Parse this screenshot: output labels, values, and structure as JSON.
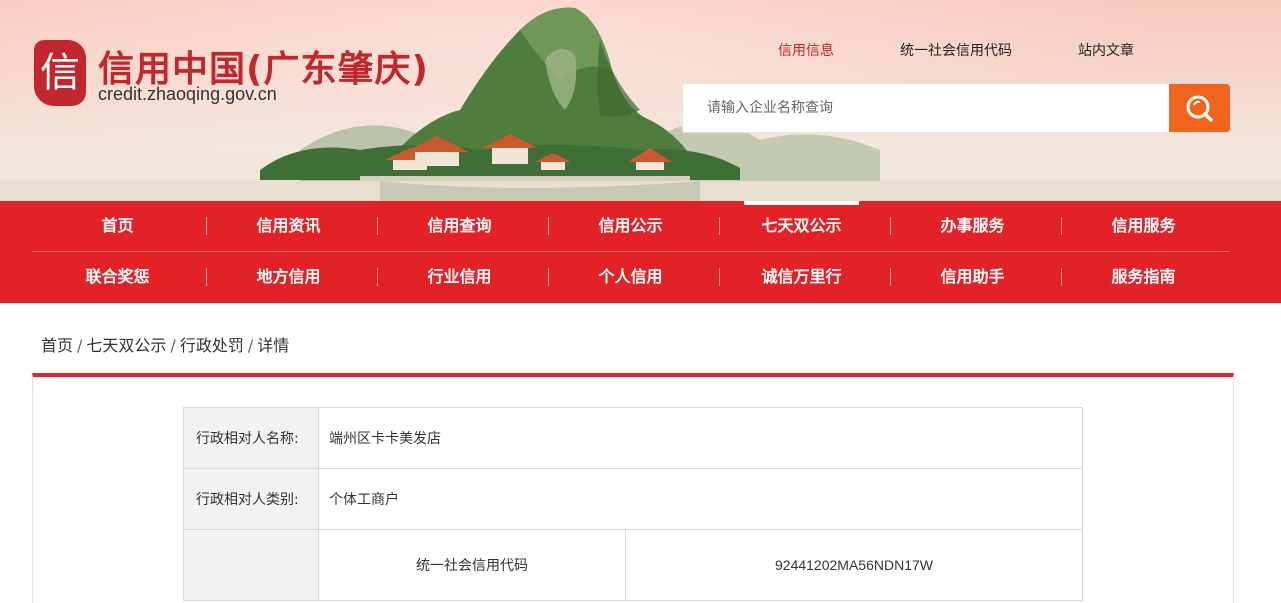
{
  "brand": {
    "seal_char": "信",
    "title": "信用中国(广东肇庆)",
    "url": "credit.zhaoqing.gov.cn"
  },
  "search": {
    "tabs": [
      {
        "label": "信用信息",
        "active": true
      },
      {
        "label": "统一社会信用代码",
        "active": false
      },
      {
        "label": "站内文章",
        "active": false
      }
    ],
    "placeholder": "请输入企业名称查询",
    "button_icon": "search-icon"
  },
  "nav": {
    "row1": [
      {
        "label": "首页"
      },
      {
        "label": "信用资讯"
      },
      {
        "label": "信用查询"
      },
      {
        "label": "信用公示"
      },
      {
        "label": "七天双公示",
        "active": true
      },
      {
        "label": "办事服务"
      },
      {
        "label": "信用服务"
      }
    ],
    "row2": [
      {
        "label": "联合奖惩"
      },
      {
        "label": "地方信用"
      },
      {
        "label": "行业信用"
      },
      {
        "label": "个人信用"
      },
      {
        "label": "诚信万里行"
      },
      {
        "label": "信用助手"
      },
      {
        "label": "服务指南"
      }
    ],
    "separator": "|"
  },
  "breadcrumb": {
    "items": [
      "首页",
      "七天双公示",
      "行政处罚",
      "详情"
    ],
    "separator": "/"
  },
  "detail": {
    "rows": [
      {
        "label": "行政相对人名称:",
        "value": "端州区卡卡美发店"
      },
      {
        "label": "行政相对人类别:",
        "value": "个体工商户"
      }
    ],
    "sub_rows": [
      {
        "label": "统一社会信用代码",
        "value": "92441202MA56NDN17W"
      }
    ]
  },
  "colors": {
    "primary_red": "#e32227",
    "brand_red": "#c1272d",
    "search_orange": "#f0651e"
  }
}
